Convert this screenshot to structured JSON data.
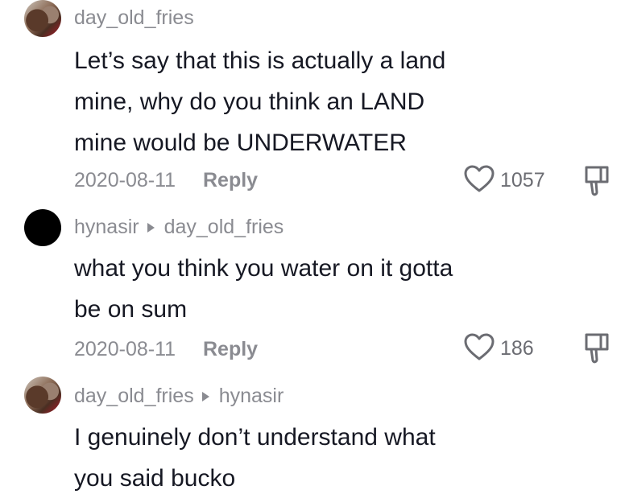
{
  "comments": [
    {
      "username": "day_old_fries",
      "reply_to": "",
      "text_lines": [
        "Let’s say that this is actually a land",
        "mine, why do you think an LAND",
        "mine would be UNDERWATER"
      ],
      "date": "2020-08-11",
      "reply_label": "Reply",
      "likes": "1057",
      "avatar": "photo"
    },
    {
      "username": "hynasir",
      "reply_to": "day_old_fries",
      "text_lines": [
        "what you think you water on it gotta",
        "be on sum"
      ],
      "date": "2020-08-11",
      "reply_label": "Reply",
      "likes": "186",
      "avatar": "black"
    },
    {
      "username": "day_old_fries",
      "reply_to": "hynasir",
      "text_lines": [
        "I genuinely don’t understand what",
        "you said bucko"
      ],
      "avatar": "photo"
    }
  ],
  "icons": {
    "like": "heart-outline-icon",
    "dislike": "thumbs-down-outline-icon",
    "reply_arrow": "caret-right-icon"
  },
  "colors": {
    "text": "#161823",
    "meta": "#8a8b91"
  }
}
